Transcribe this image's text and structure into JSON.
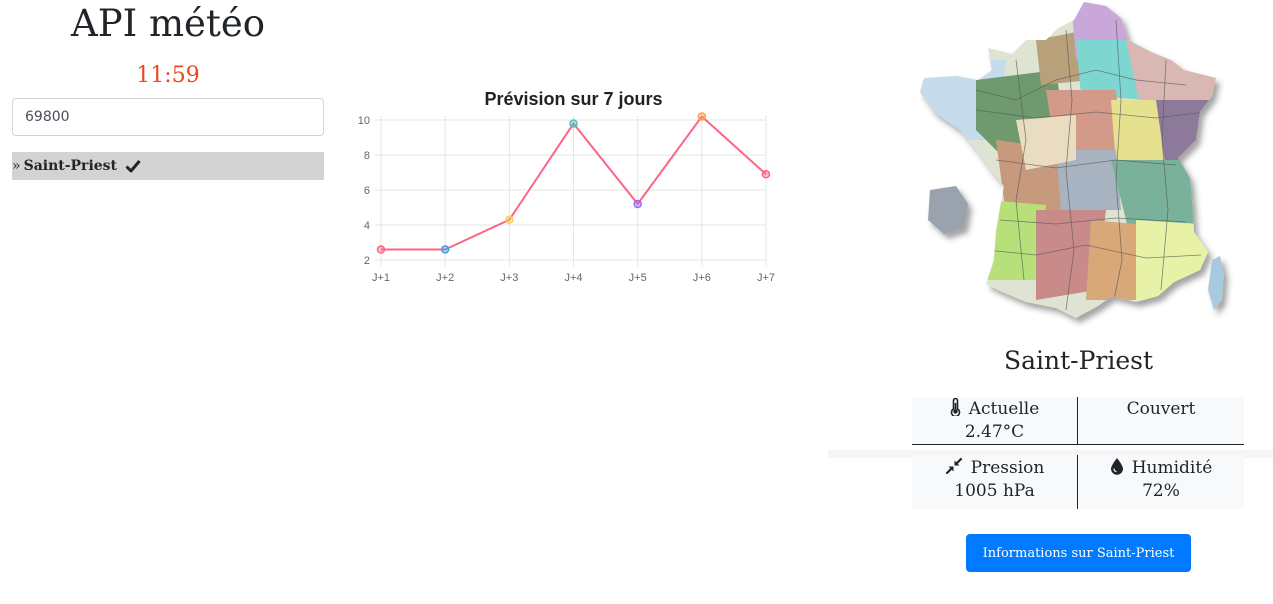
{
  "app": {
    "title": "API météo",
    "clock": "11:59"
  },
  "search": {
    "zip_value": "69800"
  },
  "results": [
    {
      "prefix": "»",
      "city": "Saint-Priest",
      "icon": "check-icon"
    }
  ],
  "chart_data": {
    "type": "line",
    "title": "Prévision sur 7 jours",
    "categories": [
      "J+1",
      "J+2",
      "J+3",
      "J+4",
      "J+5",
      "J+6",
      "J+7"
    ],
    "series": [
      {
        "values": [
          2.6,
          2.6,
          4.3,
          9.8,
          5.2,
          10.2,
          6.9
        ]
      }
    ],
    "ylim": [
      2,
      10
    ],
    "yticks": [
      2,
      4,
      6,
      8,
      10
    ],
    "grid": true,
    "line_color": "#ff6384",
    "point_colors": [
      "#ff6384",
      "#36a2eb",
      "#ffce56",
      "#4bc0c0",
      "#9966ff",
      "#ff9f40",
      "#ff6384"
    ]
  },
  "weather": {
    "city": "Saint-Priest",
    "current_label": "Actuelle",
    "current_value": "2.47°C",
    "condition": "Couvert",
    "pressure_label": "Pression",
    "pressure_value": "1005 hPa",
    "humidity_label": "Humidité",
    "humidity_value": "72%"
  },
  "info_button": {
    "label": "Informations sur Saint-Priest"
  },
  "icons": {
    "thermometer": "thermometer-icon",
    "pressure": "compress-arrows-icon",
    "humidity": "droplet-icon",
    "map": "france-departments-map"
  }
}
